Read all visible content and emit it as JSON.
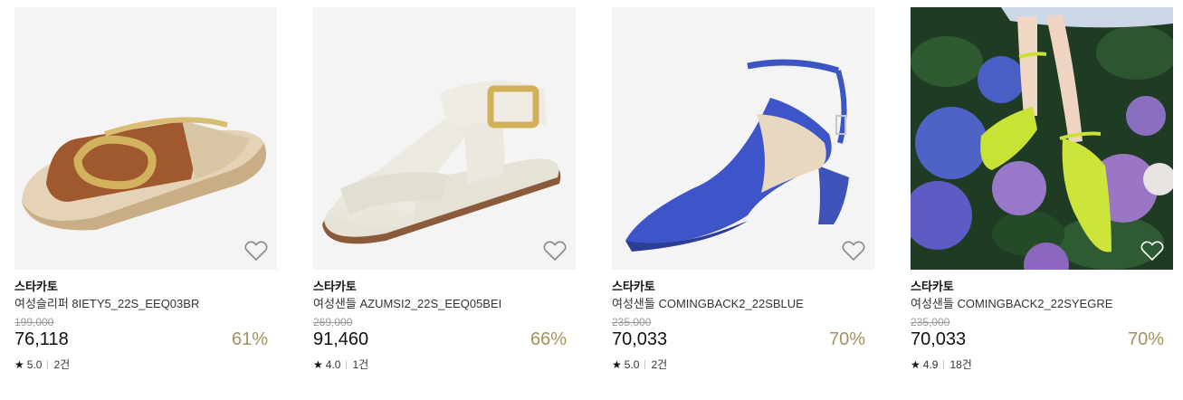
{
  "products": [
    {
      "brand": "스타카토",
      "name": "여성슬리퍼 8IETY5_22S_EEQ03BR",
      "original_price": "199,000",
      "price": "76,118",
      "discount": "61%",
      "rating": "5.0",
      "reviews": "2건",
      "image": "brown-gold-slide-sandal"
    },
    {
      "brand": "스타카토",
      "name": "여성샌들 AZUMSI2_22S_EEQ05BEI",
      "original_price": "269,000",
      "price": "91,460",
      "discount": "66%",
      "rating": "4.0",
      "reviews": "1건",
      "image": "ivory-strap-sandal"
    },
    {
      "brand": "스타카토",
      "name": "여성샌들 COMINGBACK2_22SBLUE",
      "original_price": "235,000",
      "price": "70,033",
      "discount": "70%",
      "rating": "5.0",
      "reviews": "2건",
      "image": "blue-pointed-wedge-sandal"
    },
    {
      "brand": "스타카토",
      "name": "여성샌들 COMINGBACK2_22SYEGRE",
      "original_price": "235,000",
      "price": "70,033",
      "discount": "70%",
      "rating": "4.9",
      "reviews": "18건",
      "image": "lime-sandal-hydrangea-photo"
    }
  ],
  "icons": {
    "wishlist": "heart-outline-icon",
    "rating": "star-icon"
  },
  "colors": {
    "discount": "#a5915e",
    "original_price": "#9a9a9a"
  }
}
